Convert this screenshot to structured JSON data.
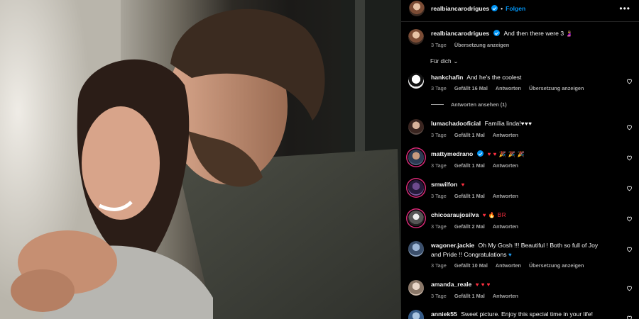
{
  "post": {
    "username": "realbiancarodrigues",
    "separator": "•",
    "follow_label": "Folgen",
    "more_icon": "more-horizontal-icon"
  },
  "caption": {
    "username": "realbiancarodrigues",
    "text": "And then there were 3",
    "emoji": "🤰",
    "time": "3 Tage",
    "translate": "Übersetzung anzeigen"
  },
  "filter": {
    "label": "Für dich",
    "icon": "chevron-down-icon"
  },
  "comments": [
    {
      "user": "hankchafin",
      "text": "And he's the coolest",
      "time": "3 Tage",
      "likes": "Gefällt 16 Mal",
      "reply": "Antworten",
      "translate": "Übersetzung anzeigen"
    },
    {
      "user": "lumachadooficial",
      "text": "Família linda!",
      "emoji": "♥♥♥",
      "time": "3 Tage",
      "likes": "Gefällt 1 Mal",
      "reply": "Antworten"
    },
    {
      "user": "mattymedrano",
      "text": "",
      "emoji": "♥ ♥ 🎉 🎉 🎉",
      "time": "3 Tage",
      "likes": "Gefällt 1 Mal",
      "reply": "Antworten"
    },
    {
      "user": "smwilfon",
      "text": "",
      "emoji": "♥",
      "time": "3 Tage",
      "likes": "Gefällt 1 Mal",
      "reply": "Antworten"
    },
    {
      "user": "chicoaraujosilva",
      "text": "",
      "emoji": "♥ 🔥 BR",
      "time": "3 Tage",
      "likes": "Gefällt 2 Mal",
      "reply": "Antworten"
    },
    {
      "user": "wagoner.jackie",
      "text": "Oh My Gosh !!! Beautiful ! Both so full of Joy and Pride !! Congratulations",
      "emoji": "♥",
      "time": "3 Tage",
      "likes": "Gefällt 10 Mal",
      "reply": "Antworten",
      "translate": "Übersetzung anzeigen"
    },
    {
      "user": "amanda_reale",
      "text": "",
      "emoji": "♥ ♥ ♥",
      "time": "3 Tage",
      "likes": "Gefällt 1 Mal",
      "reply": "Antworten"
    },
    {
      "user": "anniek55",
      "text": "Sweet picture. Enjoy this special time in your life!"
    }
  ],
  "replies_label": "Antworten ansehen (1)",
  "colors": {
    "accent": "#0095f6",
    "background": "#000000",
    "muted": "#a8a8a8",
    "like": "#ff3040"
  }
}
